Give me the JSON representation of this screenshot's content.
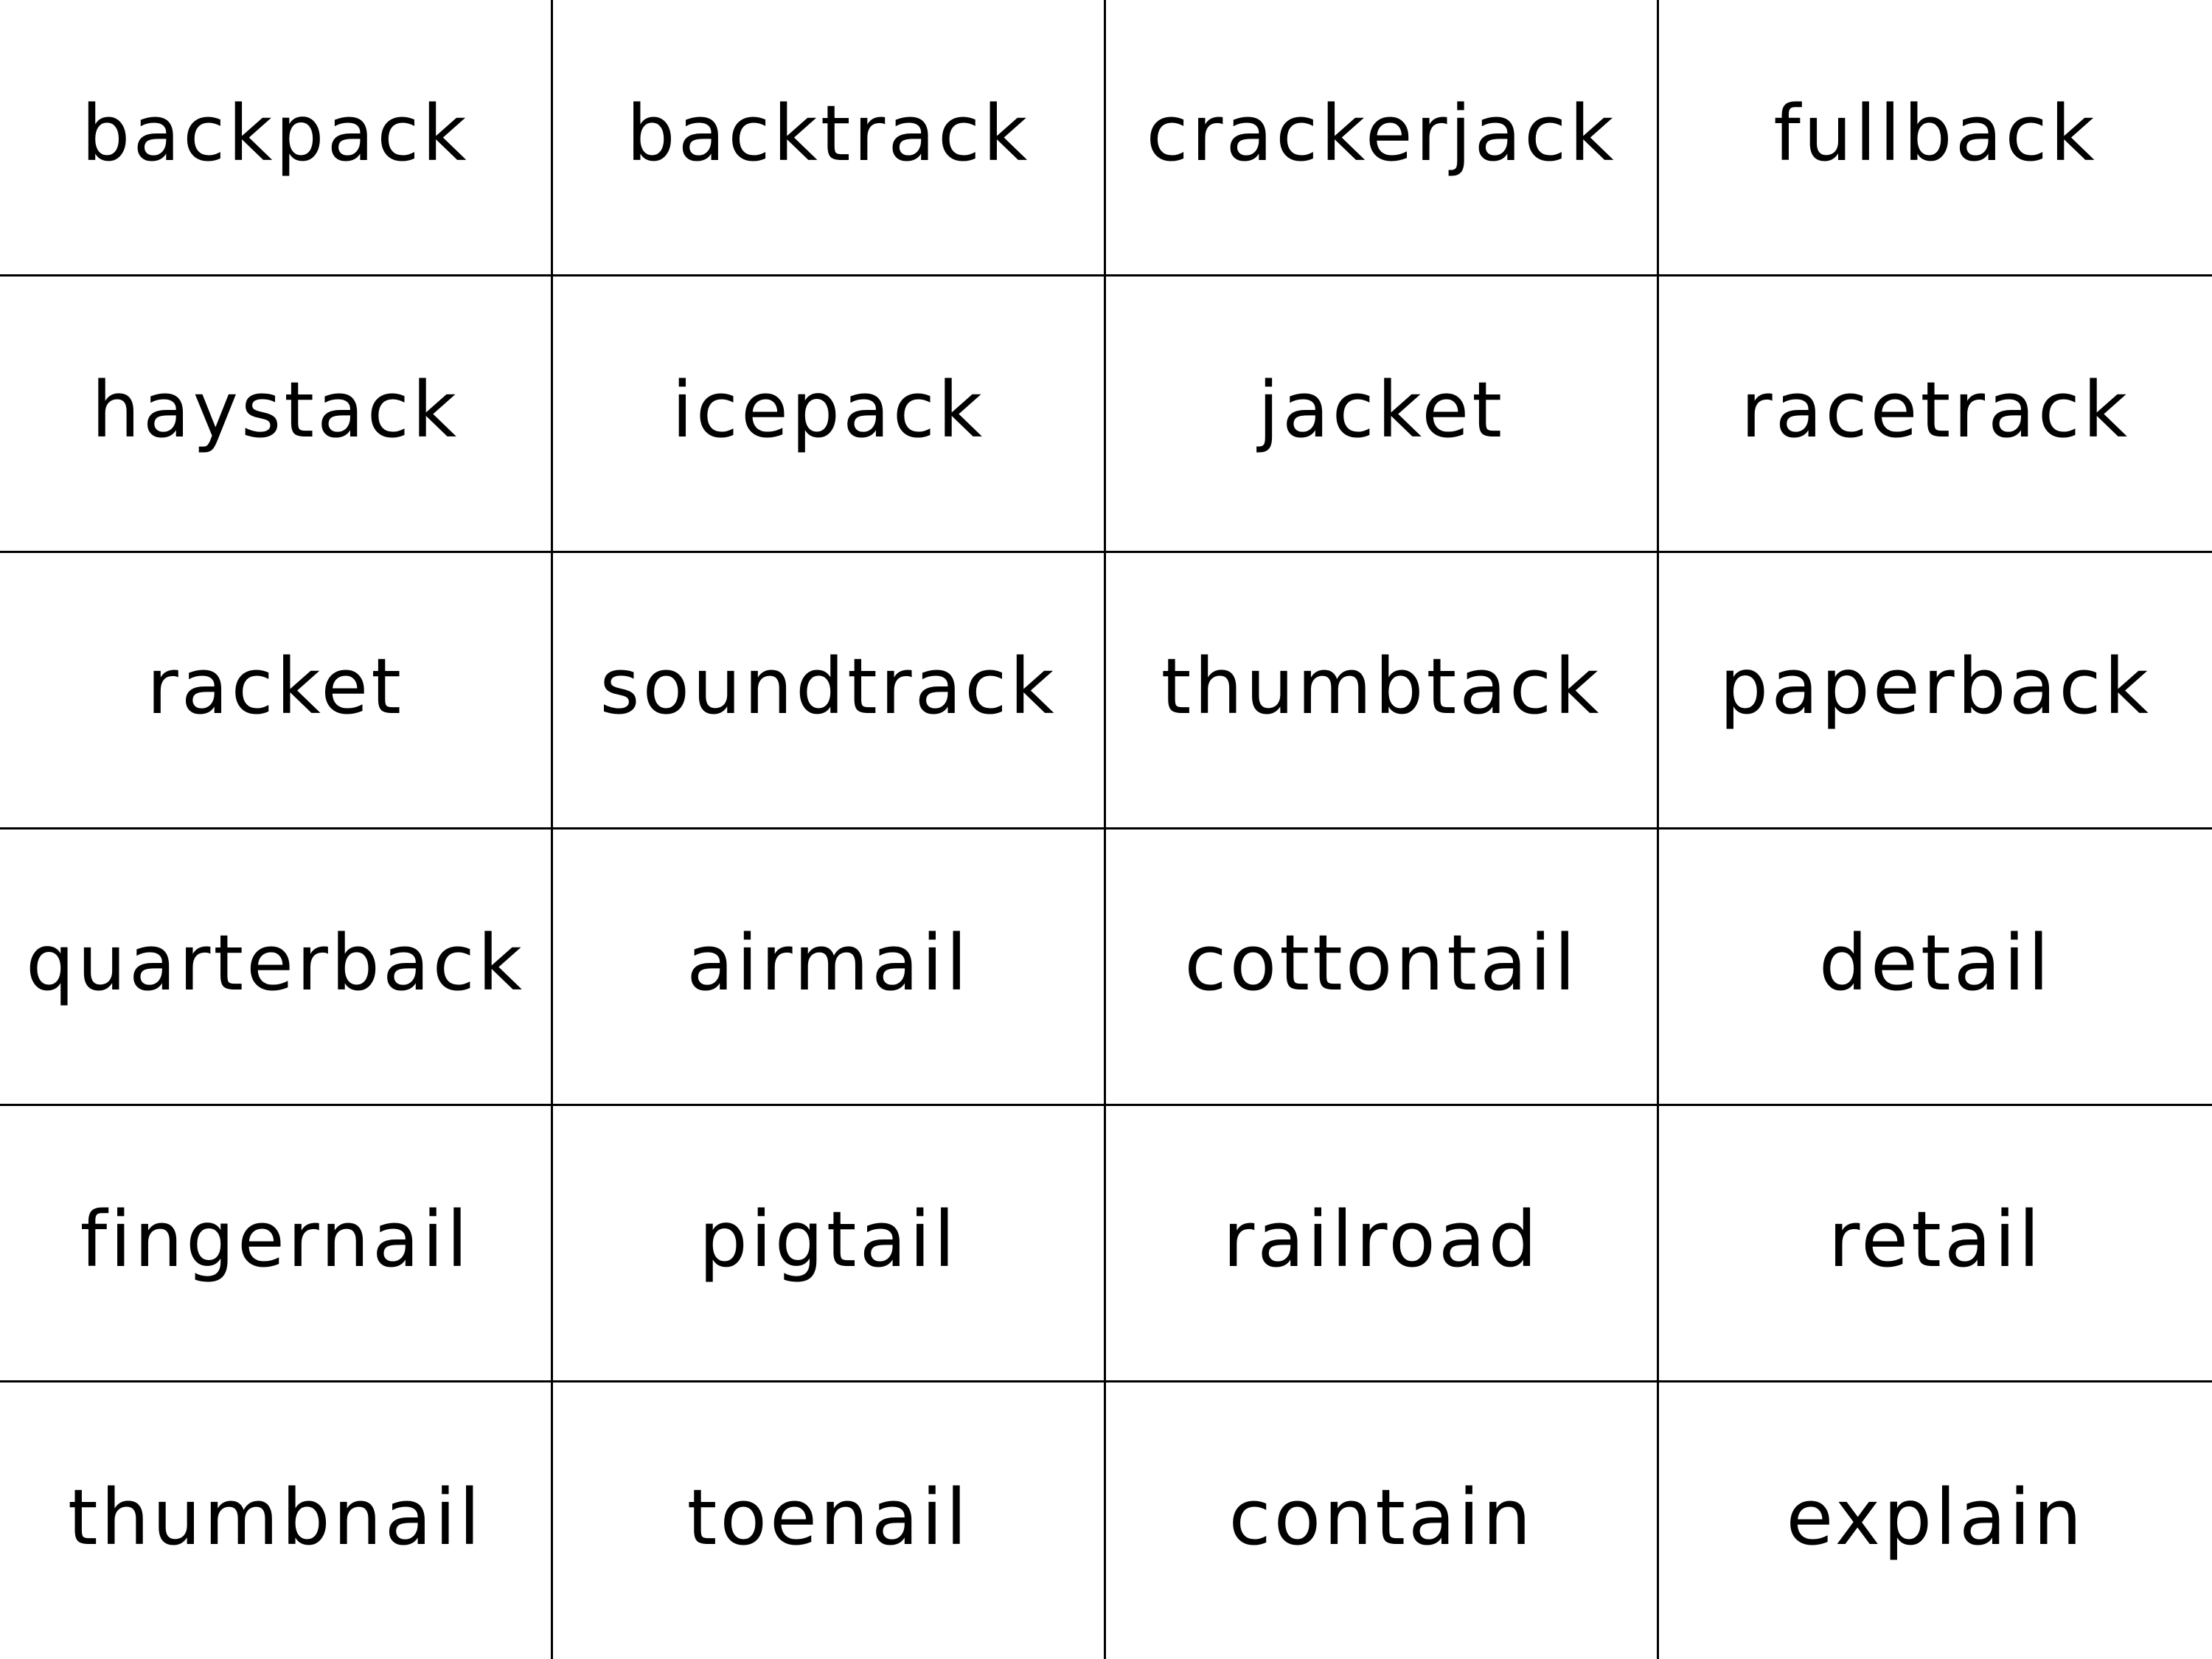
{
  "words": [
    "backpack",
    "backtrack",
    "crackerjack",
    "fullback",
    "haystack",
    "icepack",
    "jacket",
    "racetrack",
    "racket",
    "soundtrack",
    "thumbtack",
    "paperback",
    "quarterback",
    "airmail",
    "cottontail",
    "detail",
    "fingernail",
    "pigtail",
    "railroad",
    "retail",
    "thumbnail",
    "toenail",
    "contain",
    "explain"
  ],
  "colors": {
    "background": "#ffffff",
    "text": "#000000",
    "grid_line": "#000000"
  }
}
